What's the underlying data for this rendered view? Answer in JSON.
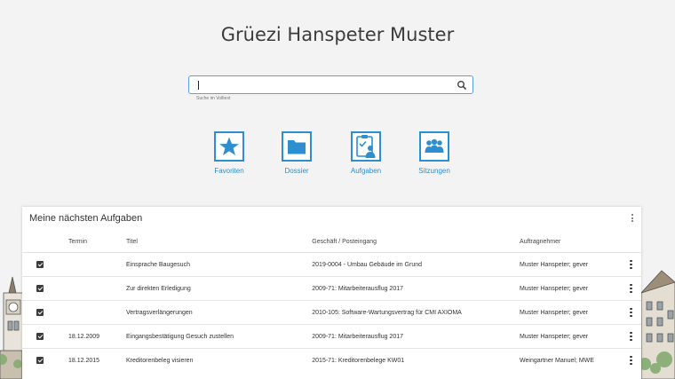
{
  "greeting": "Grüezi Hanspeter Muster",
  "search": {
    "value": "",
    "hint": "Suche im Volltext",
    "icon": "search-icon"
  },
  "tiles": [
    {
      "label": "Favoriten",
      "icon": "star-icon"
    },
    {
      "label": "Dossier",
      "icon": "folder-icon"
    },
    {
      "label": "Aufgaben",
      "icon": "clipboard-task-icon"
    },
    {
      "label": "Sitzungen",
      "icon": "group-icon"
    }
  ],
  "tasks": {
    "title": "Meine nächsten Aufgaben",
    "headers": {
      "termin": "Termin",
      "titel": "Titel",
      "geschaeft": "Geschäft / Posteingang",
      "auftragnehmer": "Auftragnehmer"
    },
    "rows": [
      {
        "termin": "",
        "titel": "Einsprache Baugesuch",
        "geschaeft": "2019-0004 - Umbau Gebäude im Grund",
        "auftragnehmer": "Muster Hanspeter; gever"
      },
      {
        "termin": "",
        "titel": "Zur direkten Erledigung",
        "geschaeft": "2009-71: Mitarbeiterausflug 2017",
        "auftragnehmer": "Muster Hanspeter; gever"
      },
      {
        "termin": "",
        "titel": "Vertragsverlängerungen",
        "geschaeft": "2010-105: Software-Wartungsvertrag für CMI AXIOMA",
        "auftragnehmer": "Muster Hanspeter; gever"
      },
      {
        "termin": "18.12.2009",
        "titel": "Eingangsbestätigung Gesuch zustellen",
        "geschaeft": "2009-71: Mitarbeiterausflug 2017",
        "auftragnehmer": "Muster Hanspeter; gever"
      },
      {
        "termin": "18.12.2015",
        "titel": "Kreditorenbeleg visieren",
        "geschaeft": "2015-71: Kreditorenbelege KW01",
        "auftragnehmer": "Weingartner Manuel; MWE"
      }
    ]
  },
  "colors": {
    "accent": "#2d8fd0",
    "background": "#f3f3f3"
  }
}
